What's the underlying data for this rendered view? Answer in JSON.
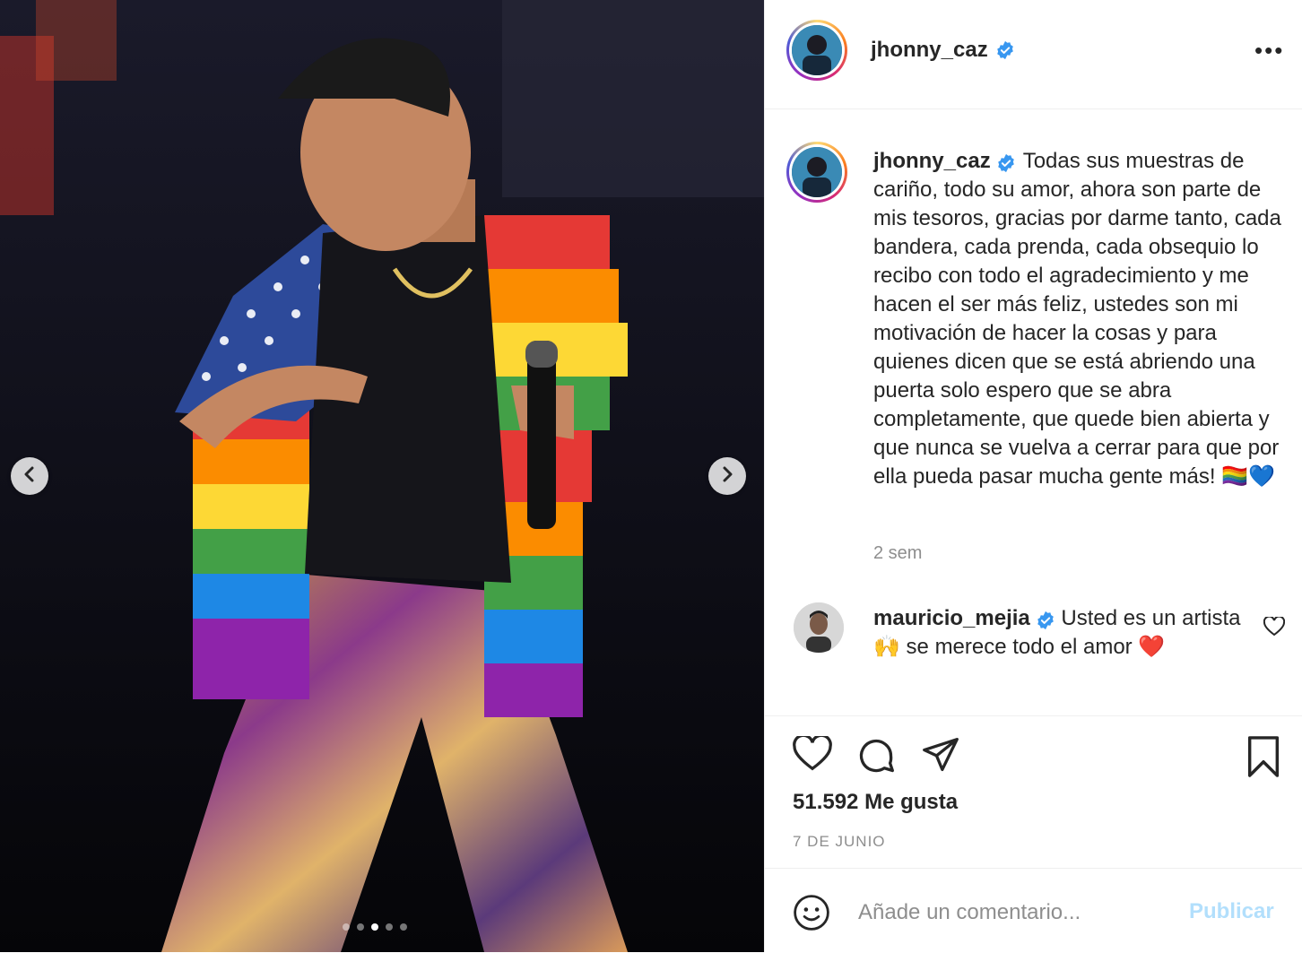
{
  "media": {
    "photo_icon": "concert-photo",
    "prev_icon": "chevron-left-icon",
    "next_icon": "chevron-right-icon",
    "carousel": {
      "count": 5,
      "active_index": 2
    }
  },
  "header": {
    "username": "jhonny_caz",
    "verified": true,
    "more_icon": "ellipsis-icon",
    "more_label": "•••"
  },
  "caption": {
    "username": "jhonny_caz",
    "text": "Todas sus muestras de cariño, todo su amor, ahora son parte de mis tesoros, gracias por darme tanto, cada bandera, cada prenda, cada obsequio lo recibo con todo el agradecimiento y me hacen el ser más feliz, ustedes son mi motivación de hacer la cosas y para quienes dicen que se está abriendo una puerta solo espero que se abra completamente, que quede bien abierta y que nunca se vuelva a cerrar para que por ella pueda pasar mucha gente más! 🏳️‍🌈💙",
    "time_ago": "2 sem"
  },
  "comments": [
    {
      "username": "mauricio_mejia",
      "verified": true,
      "text": "Usted es un artista 🙌 se merece todo el amor ❤️"
    }
  ],
  "actions": {
    "like_icon": "heart-icon",
    "comment_icon": "comment-bubble-icon",
    "share_icon": "paper-plane-icon",
    "save_icon": "bookmark-icon",
    "likes": "51.592 Me gusta",
    "date": "7 DE JUNIO"
  },
  "add_comment": {
    "emoji_icon": "smiley-icon",
    "placeholder": "Añade un comentario...",
    "publish_label": "Publicar"
  },
  "colors": {
    "verified": "#3897f0",
    "publish_disabled": "#b2dffc",
    "muted": "#8e8e8e",
    "text": "#262626"
  }
}
